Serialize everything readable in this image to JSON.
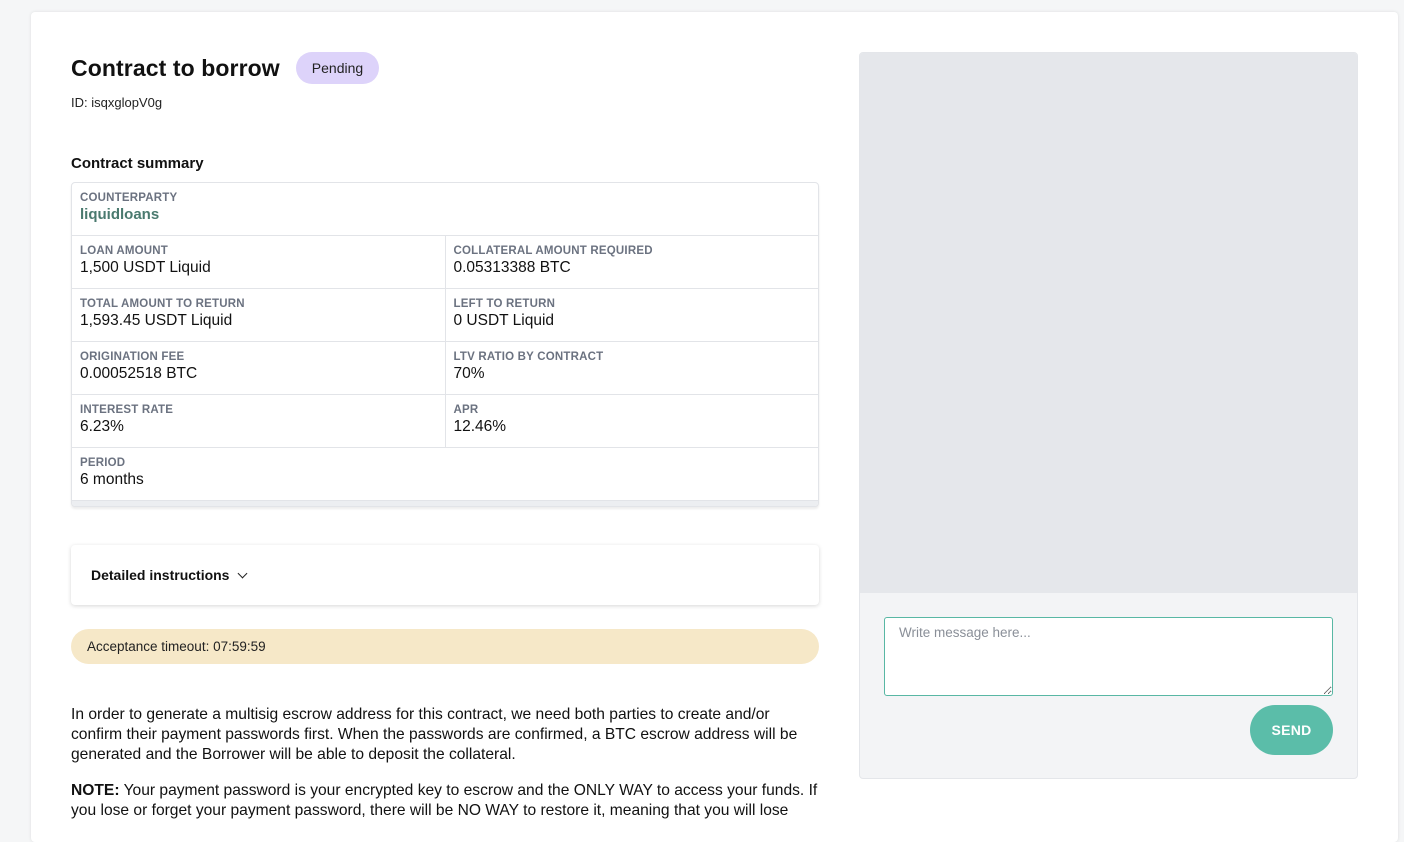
{
  "header": {
    "title": "Contract to borrow",
    "status": "Pending",
    "contract_id": "ID: isqxglopV0g"
  },
  "summary": {
    "heading": "Contract summary",
    "counterparty_label": "COUNTERPARTY",
    "counterparty_value": "liquidloans",
    "loan_amount_label": "LOAN AMOUNT",
    "loan_amount_value": "1,500 USDT Liquid",
    "collateral_label": "COLLATERAL AMOUNT REQUIRED",
    "collateral_value": "0.05313388 BTC",
    "total_return_label": "TOTAL AMOUNT TO RETURN",
    "total_return_value": "1,593.45 USDT Liquid",
    "left_return_label": "LEFT TO RETURN",
    "left_return_value": "0 USDT Liquid",
    "origination_fee_label": "ORIGINATION FEE",
    "origination_fee_value": "0.00052518 BTC",
    "ltv_label": "LTV RATIO BY CONTRACT",
    "ltv_value": "70%",
    "interest_label": "INTEREST RATE",
    "interest_value": "6.23%",
    "apr_label": "APR",
    "apr_value": "12.46%",
    "period_label": "PERIOD",
    "period_value": "6 months"
  },
  "instructions": {
    "label": "Detailed instructions"
  },
  "timeout": {
    "text": "Acceptance timeout: 07:59:59"
  },
  "body": {
    "paragraph": "In order to generate a multisig escrow address for this contract, we need both parties to create and/or confirm their payment passwords first. When the passwords are confirmed, a BTC escrow address will be generated and the Borrower will be able to deposit the collateral.",
    "note_label": "NOTE:",
    "note_text": " Your payment password is your encrypted key to escrow and the ONLY WAY to access your funds. If you lose or forget your payment password, there will be NO WAY to restore it, meaning that you will lose"
  },
  "chat": {
    "placeholder": "Write message here...",
    "send_label": "SEND"
  },
  "colors": {
    "accent": "#5bbda9",
    "pending_badge": "#ddd3fa",
    "timeout_bg": "#f6e8c8",
    "link": "#4a7a6f"
  }
}
